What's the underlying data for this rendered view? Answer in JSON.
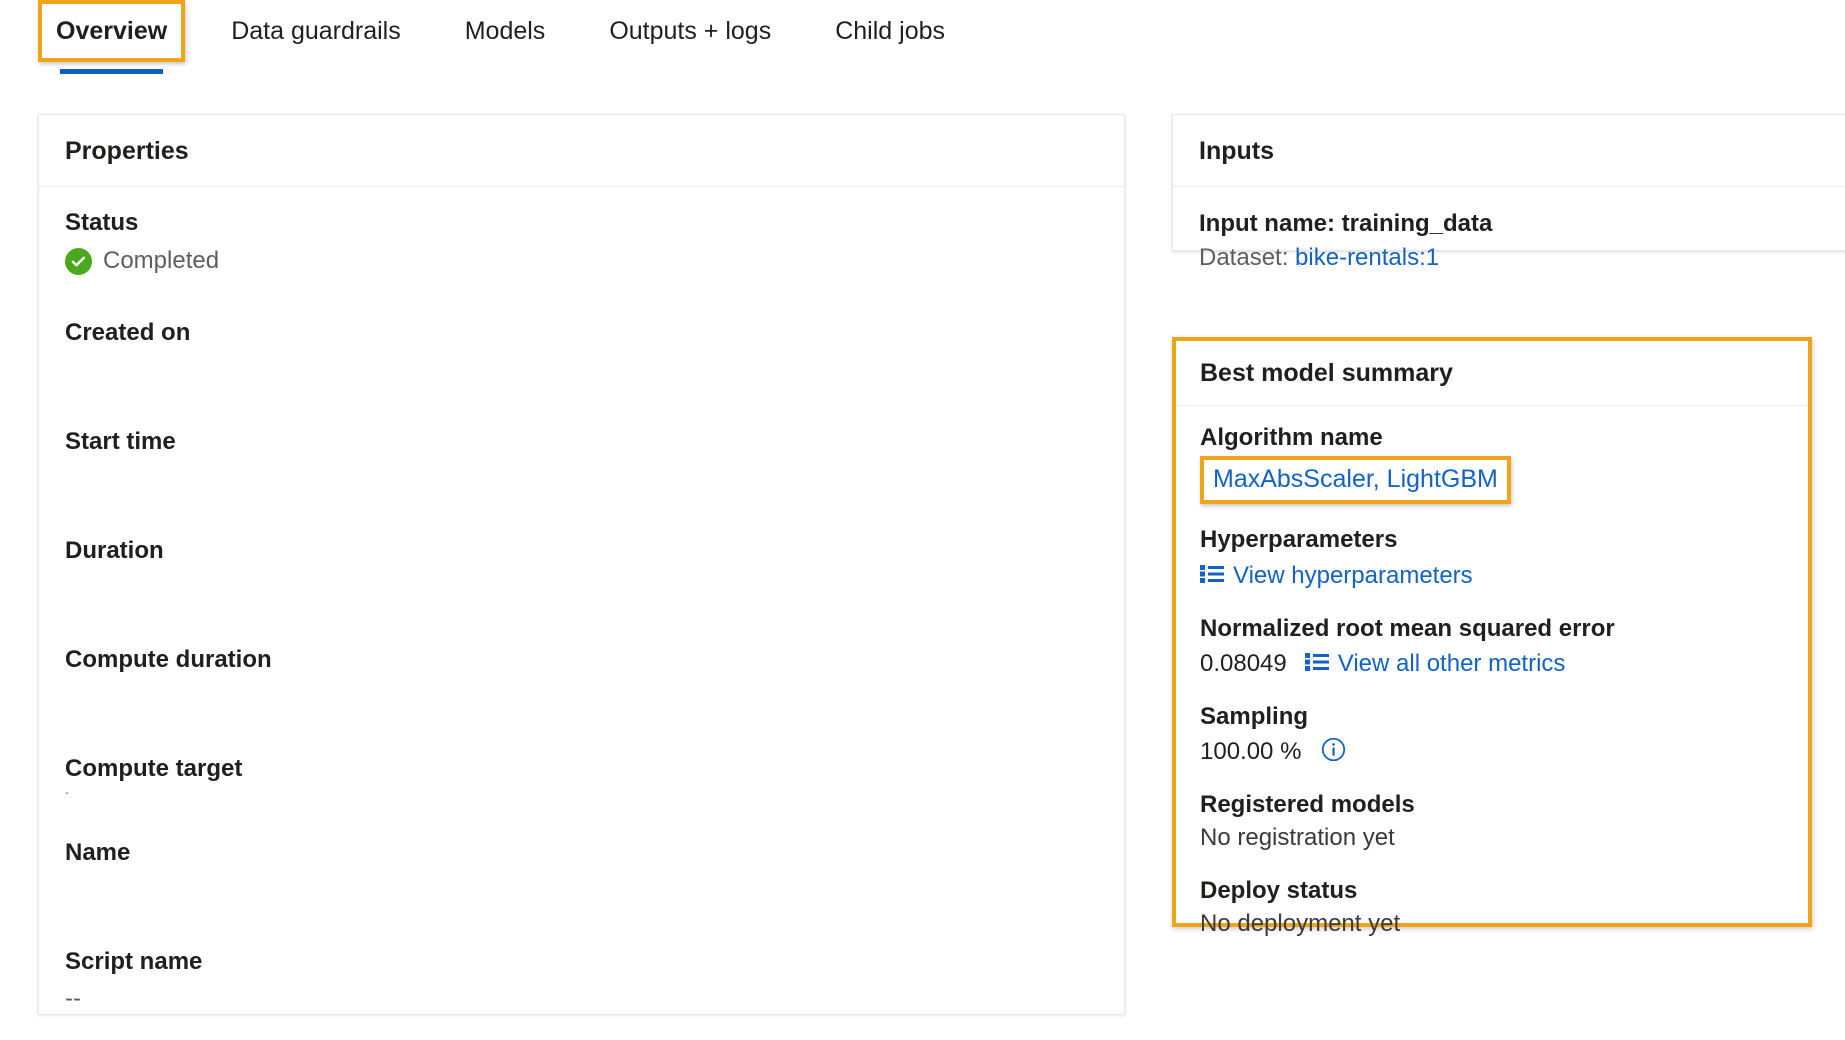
{
  "tabs": [
    {
      "label": "Overview",
      "selected": true
    },
    {
      "label": "Data guardrails",
      "selected": false
    },
    {
      "label": "Models",
      "selected": false
    },
    {
      "label": "Outputs + logs",
      "selected": false
    },
    {
      "label": "Child jobs",
      "selected": false
    }
  ],
  "properties": {
    "header": "Properties",
    "rows": [
      {
        "label": "Status",
        "value": "Completed",
        "icon": "check-circle-icon"
      },
      {
        "label": "Created on",
        "value": ""
      },
      {
        "label": "Start time",
        "value": ""
      },
      {
        "label": "Duration",
        "value": ""
      },
      {
        "label": "Compute duration",
        "value": ""
      },
      {
        "label": "Compute target",
        "value": "-"
      },
      {
        "label": "Name",
        "value": ""
      },
      {
        "label": "Script name",
        "value": "--"
      }
    ]
  },
  "inputs": {
    "header": "Inputs",
    "input_name_label": "Input name: training_data",
    "dataset_label": "Dataset: ",
    "dataset_link": "bike-rentals:1"
  },
  "best_model": {
    "header": "Best model summary",
    "algorithm_label": "Algorithm name",
    "algorithm_link": "MaxAbsScaler, LightGBM",
    "hyperparameters_label": "Hyperparameters",
    "hyperparameters_link": "View hyperparameters",
    "metric_label": "Normalized root mean squared error",
    "metric_value": "0.08049",
    "metric_link": "View all other metrics",
    "sampling_label": "Sampling",
    "sampling_value": "100.00 %",
    "registered_models_label": "Registered models",
    "registered_models_value": "No registration yet",
    "deploy_status_label": "Deploy status",
    "deploy_status_value": "No deployment yet"
  },
  "colors": {
    "highlight": "#f0a418",
    "link": "#1462c4",
    "success": "#4aa81c",
    "tab_underline": "#0e5ec4"
  }
}
